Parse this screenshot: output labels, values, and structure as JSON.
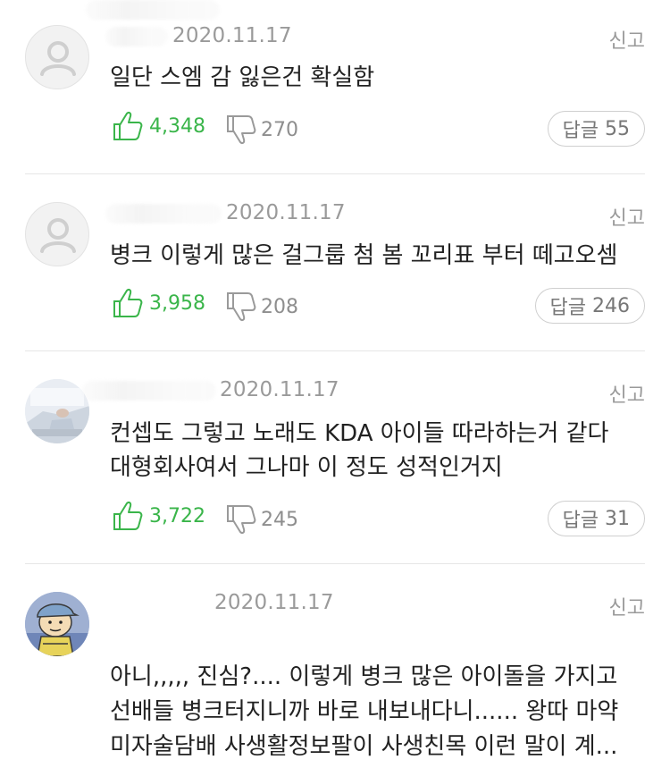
{
  "comments": [
    {
      "date": "2020.11.17",
      "report_label": "신고",
      "text_lines": [
        "일단 스엠 감 잃은건 확실함"
      ],
      "likes": "4,348",
      "dislikes": "270",
      "reply_label": "답글",
      "reply_count": "55",
      "avatar": "default-user-icon"
    },
    {
      "date": "2020.11.17",
      "report_label": "신고",
      "text_lines": [
        "병크 이렇게 많은 걸그룹 첨 봄 꼬리표 부터 떼고오셈"
      ],
      "likes": "3,958",
      "dislikes": "208",
      "reply_label": "답글",
      "reply_count": "246",
      "avatar": "default-user-icon"
    },
    {
      "date": "2020.11.17",
      "report_label": "신고",
      "text_lines": [
        "컨셉도 그렇고 노래도 KDA 아이들 따라하는거 같다",
        "대형회사여서 그나마 이 정도 성적인거지"
      ],
      "likes": "3,722",
      "dislikes": "245",
      "reply_label": "답글",
      "reply_count": "31",
      "avatar": "photo-avatar"
    },
    {
      "date": "2020.11.17",
      "report_label": "신고",
      "text_lines": [
        "아니,,,,, 진심?.... 이렇게 병크 많은 아이돌을 가지고",
        "선배들 병크터지니까 바로 내보내다니...... 왕따 마약",
        "미자술담배 사생활정보팔이 사생친목 이런 말이 계..."
      ],
      "avatar": "cartoon-avatar"
    }
  ],
  "colors": {
    "like": "#3ab54a",
    "muted": "#9a9a9a",
    "divider": "#e6e6e6"
  }
}
